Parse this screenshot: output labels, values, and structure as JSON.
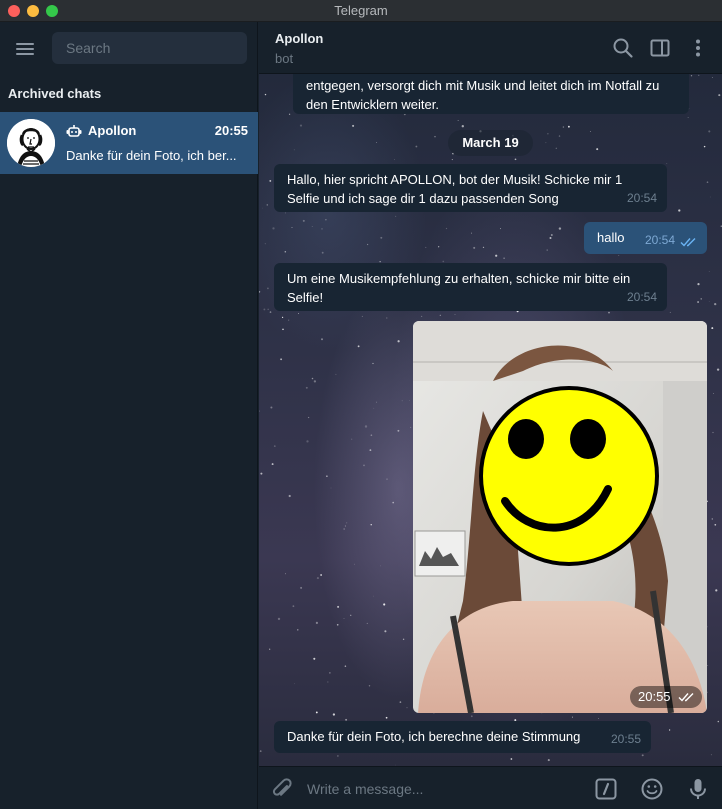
{
  "window": {
    "title": "Telegram"
  },
  "sidebar": {
    "search_placeholder": "Search",
    "section_title": "Archived chats",
    "chats": [
      {
        "name": "Apollon",
        "time": "20:55",
        "preview": "Danke für dein Foto, ich ber...",
        "is_bot": true
      }
    ]
  },
  "header": {
    "name": "Apollon",
    "status": "bot"
  },
  "messages": {
    "m0": {
      "text": "entgegen, versorgt dich mit Musik und leitet dich im Notfall zu den Entwicklern weiter."
    },
    "date": "March 19",
    "m1": {
      "text": "Hallo, hier spricht APOLLON, bot der Musik! Schicke mir 1 Selfie und ich sage dir 1 dazu passenden Song",
      "time": "20:54"
    },
    "m2": {
      "text": "hallo",
      "time": "20:54"
    },
    "m3": {
      "text": "Um eine Musikempfehlung zu erhalten, schicke mir bitte ein Selfie!",
      "time": "20:54"
    },
    "photo": {
      "time": "20:55"
    },
    "m4": {
      "text": "Danke für dein Foto, ich berechne deine Stimmung",
      "time": "20:55"
    }
  },
  "composer": {
    "placeholder": "Write a message..."
  },
  "colors": {
    "sidebar_bg": "#17212b",
    "selected_chat": "#2b5278",
    "incoming_bubble": "#182533",
    "outgoing_bubble": "#2b5278",
    "read_ticks": "#6ab3f3",
    "smiley": "#ffff00"
  },
  "icons": [
    "menu-icon",
    "bot-icon",
    "search-icon",
    "sidebar-toggle-icon",
    "more-vertical-icon",
    "double-check-icon",
    "attach-icon",
    "bot-command-icon",
    "emoji-icon",
    "microphone-icon"
  ]
}
